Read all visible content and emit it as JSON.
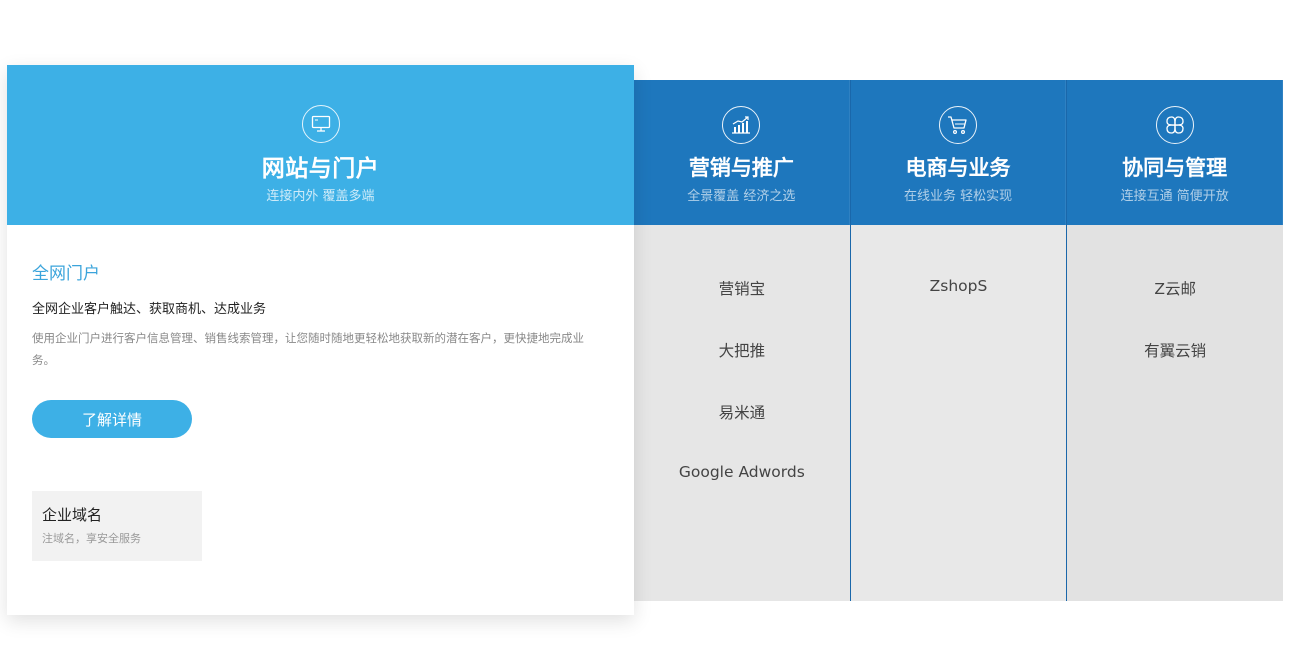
{
  "active": {
    "icon": "monitor-icon",
    "title": "网站与门户",
    "subtitle": "连接内外 覆盖多端",
    "product_title": "全网门户",
    "product_lead": "全网企业客户触达、获取商机、达成业务",
    "product_desc": "使用企业门户进行客户信息管理、销售线索管理，让您随时随地更轻松地获取新的潜在客户，更快捷地完成业务。",
    "button_label": "了解详情",
    "card": {
      "title": "企业域名",
      "subtitle": "注域名，享安全服务"
    }
  },
  "columns": [
    {
      "icon": "growth-chart-icon",
      "title": "营销与推广",
      "subtitle": "全景覆盖 经济之选",
      "items": [
        "营销宝",
        "大把推",
        "易米通",
        "Google Adwords"
      ]
    },
    {
      "icon": "shopping-cart-icon",
      "title": "电商与业务",
      "subtitle": "在线业务 轻松实现",
      "items": [
        "ZshopS"
      ]
    },
    {
      "icon": "collaboration-icon",
      "title": "协同与管理",
      "subtitle": "连接互通 简便开放",
      "items": [
        "Z云邮",
        "有翼云销"
      ]
    }
  ],
  "colors": {
    "active_header": "#3db0e6",
    "column_header": "#1e77bd",
    "accent_text": "#3ba4db"
  }
}
